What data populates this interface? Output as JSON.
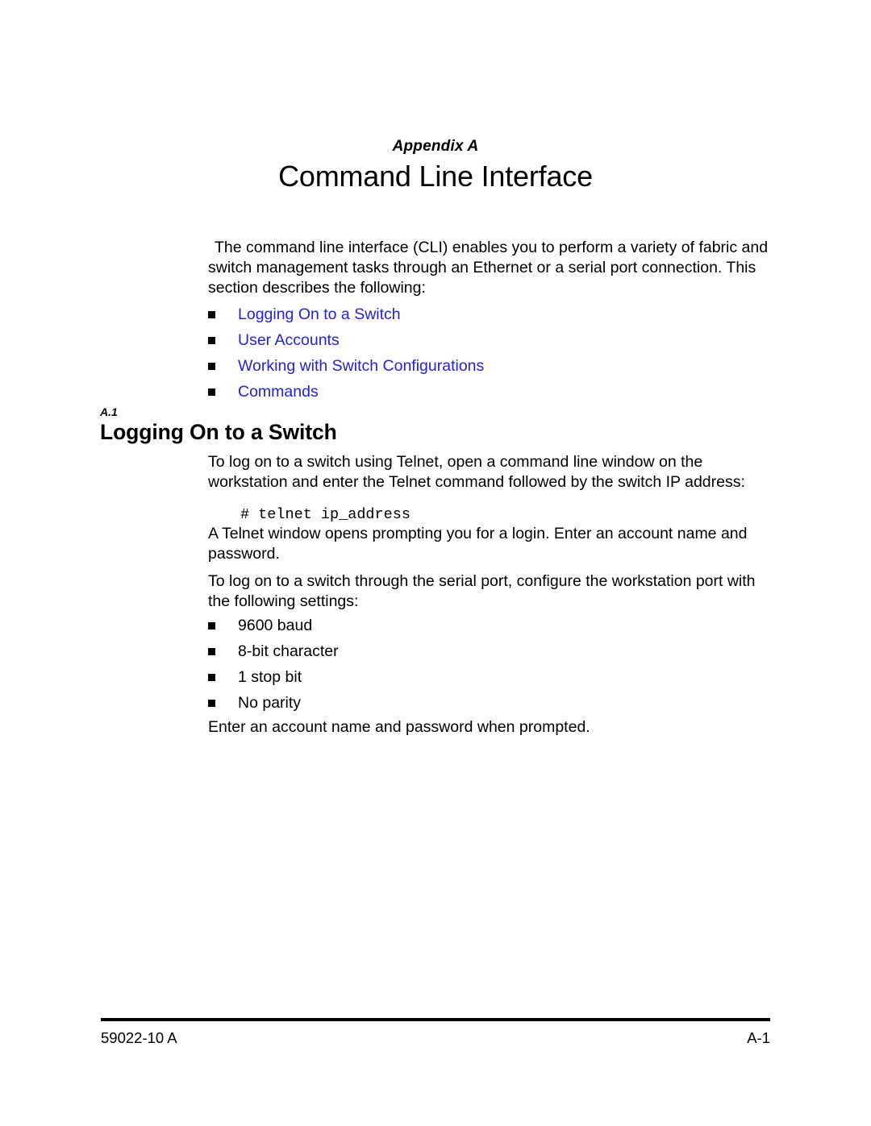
{
  "page": {
    "appendix_label": "Appendix A",
    "appendix_title": "Command Line Interface"
  },
  "intro": {
    "paragraph": "The command line interface (CLI) enables you to perform a variety of fabric and switch management tasks through an Ethernet or a serial port connection. This section describes the following:"
  },
  "toc_links": [
    {
      "label": "Logging On to a Switch"
    },
    {
      "label": "User Accounts"
    },
    {
      "label": "Working with Switch Configurations"
    },
    {
      "label": "Commands"
    }
  ],
  "section": {
    "number": "A.1",
    "title": "Logging On to a Switch",
    "telnet_intro": "To log on to a switch using Telnet, open a command line window on the workstation and enter the Telnet command followed by the switch IP address:",
    "code": "# telnet ip_address",
    "telnet_after": "A Telnet window opens prompting you for a login. Enter an account name and password.",
    "serial_intro": "To log on to a switch through the serial port, configure the workstation port with the following settings:",
    "closing": "Enter an account name and password when prompted."
  },
  "serial_settings": [
    {
      "label": "9600 baud"
    },
    {
      "label": "8-bit character"
    },
    {
      "label": "1 stop bit"
    },
    {
      "label": "No parity"
    }
  ],
  "footer": {
    "left": "59022-10  A",
    "right": "A-1"
  },
  "colors": {
    "link": "#2121E8",
    "text": "#000000",
    "background": "#FFFFFF"
  }
}
